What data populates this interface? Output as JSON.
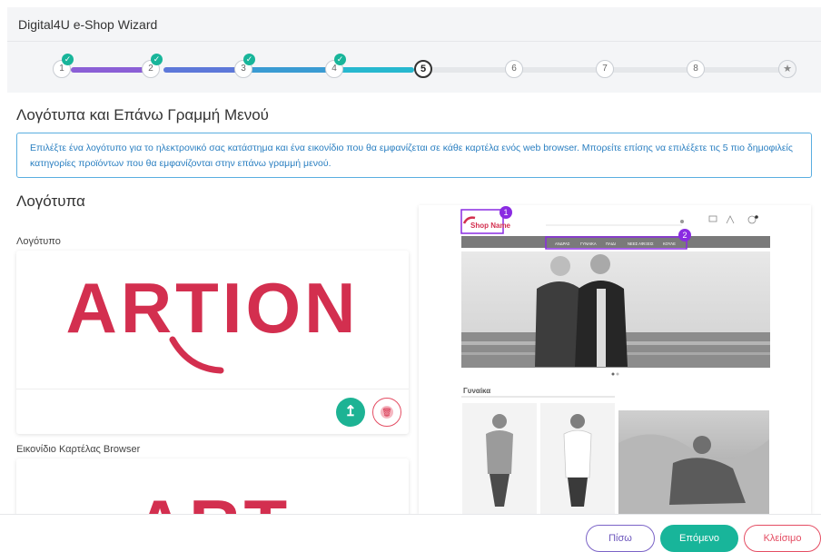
{
  "header": {
    "title": "Digital4U e-Shop Wizard"
  },
  "stepper": {
    "steps": [
      "1",
      "2",
      "3",
      "4",
      "5",
      "6",
      "7",
      "8"
    ],
    "current_step": 5,
    "completed_check": "✓",
    "final_icon": "star-icon"
  },
  "section": {
    "title": "Λογότυπα και Επάνω Γραμμή Μενού",
    "info": "Επιλέξτε ένα λογότυπο για το ηλεκτρονικό σας κατάστημα και ένα εικονίδιο που θα εμφανίζεται σε κάθε καρτέλα ενός web browser. Μπορείτε επίσης να επιλέξετε τις 5 πιο δημοφιλείς κατηγορίες προϊόντων που θα εμφανίζονται στην επάνω γραμμή μενού."
  },
  "logos": {
    "title": "Λογότυπα",
    "logo_label": "Λογότυπο",
    "logo_text": "ARTION",
    "favicon_label": "Εικονίδιο Καρτέλας Browser",
    "favicon_text": "ART",
    "upload_symbol": "↥",
    "delete_symbol": "🗑"
  },
  "preview": {
    "shop_name": "Shop Name",
    "badge_1": "1",
    "badge_2": "2",
    "menu_items": [
      "ΑΝΔΡΑΣ",
      "ΓΥΝΑΙΚΑ",
      "ΠΑΙΔΙ",
      "ΝΕΕΣ ΑΦΙΞΕΙΣ",
      "ΚΟΥΛΕ"
    ],
    "category_title": "Γυναίκα"
  },
  "footer": {
    "back": "Πίσω",
    "next": "Επόμενο",
    "close": "Κλείσιμο"
  },
  "colors": {
    "accent_green": "#18b59a",
    "brand_red": "#d32f4f",
    "info_blue": "#2a7fc1",
    "badge_purple": "#8a2be2"
  }
}
